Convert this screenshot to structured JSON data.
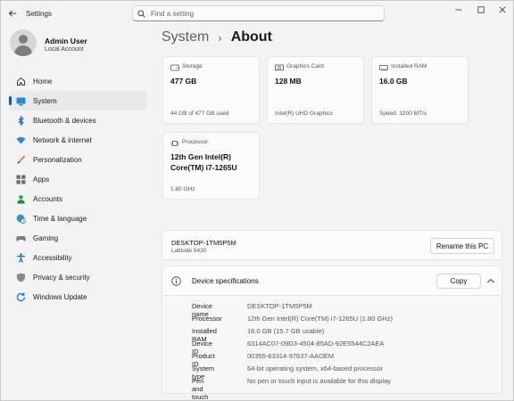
{
  "titlebar": {
    "app_title": "Settings",
    "search_placeholder": "Find a setting"
  },
  "profile": {
    "name": "Admin User",
    "account": "Local Account"
  },
  "nav": [
    {
      "label": "Home",
      "icon": "home-icon"
    },
    {
      "label": "System",
      "icon": "system-icon",
      "active": true
    },
    {
      "label": "Bluetooth & devices",
      "icon": "bluetooth-icon"
    },
    {
      "label": "Network & internet",
      "icon": "network-icon"
    },
    {
      "label": "Personalization",
      "icon": "brush-icon"
    },
    {
      "label": "Apps",
      "icon": "apps-icon"
    },
    {
      "label": "Accounts",
      "icon": "accounts-icon"
    },
    {
      "label": "Time & language",
      "icon": "globe-clock-icon"
    },
    {
      "label": "Gaming",
      "icon": "gamepad-icon"
    },
    {
      "label": "Accessibility",
      "icon": "accessibility-icon"
    },
    {
      "label": "Privacy & security",
      "icon": "shield-icon"
    },
    {
      "label": "Windows Update",
      "icon": "windows-update-icon"
    }
  ],
  "breadcrumb": {
    "parent": "System",
    "separator": "›",
    "current": "About"
  },
  "cards": {
    "storage": {
      "label": "Storage",
      "value": "477 GB",
      "foot": "44 GB of 477 GB used"
    },
    "graphics": {
      "label": "Graphics Card",
      "value": "128 MB",
      "foot": "Intel(R) UHD Graphics"
    },
    "ram": {
      "label": "Installed RAM",
      "value": "16.0 GB",
      "foot": "Speed: 3200 MT/s"
    },
    "processor": {
      "label": "Processor",
      "value_line1": "12th Gen Intel(R)",
      "value_line2": "Core(TM) i7-1265U",
      "foot": "1.80 GHz"
    }
  },
  "device": {
    "pc_name": "DESKTOP-1TM5P5M",
    "model": "Latitude 5430",
    "rename_label": "Rename this PC"
  },
  "specs": {
    "title": "Device specifications",
    "copy_label": "Copy",
    "rows": [
      {
        "key": "Device name",
        "value": "DESKTOP-1TM5P5M"
      },
      {
        "key": "Processor",
        "value": "12th Gen Intel(R) Core(TM) i7-1265U (1.80 GHz)"
      },
      {
        "key": "Installed RAM",
        "value": "16.0 GB (15.7 GB usable)"
      },
      {
        "key": "Device ID",
        "value": "6314AC07-09D3-4504-85AD-92E5544C2AEA"
      },
      {
        "key": "Product ID",
        "value": "00355-63314-97637-AAOEM"
      },
      {
        "key": "System type",
        "value": "64-bit operating system, x64-based processor"
      },
      {
        "key": "Pen and touch",
        "value": "No pen or touch input is available for this display"
      }
    ]
  },
  "colors": {
    "accent": "#005fb8",
    "background": "#f3f3f3",
    "card": "#fbfbfb"
  }
}
